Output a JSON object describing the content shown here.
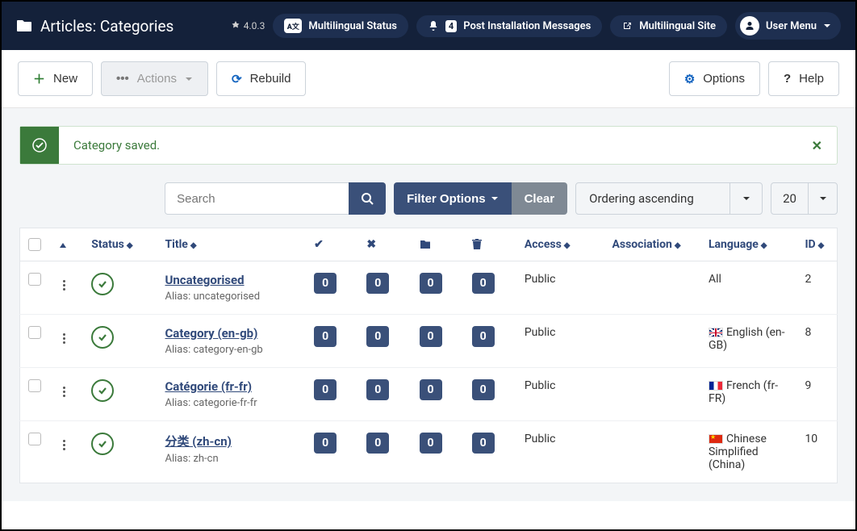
{
  "header": {
    "title": "Articles: Categories",
    "version": "4.0.3",
    "multilingual_status": "Multilingual Status",
    "notifications_count": "4",
    "post_install": "Post Installation Messages",
    "multilingual_site": "Multilingual Site",
    "user_menu": "User Menu"
  },
  "toolbar": {
    "new": "New",
    "actions": "Actions",
    "rebuild": "Rebuild",
    "options": "Options",
    "help": "Help"
  },
  "alert": {
    "message": "Category saved."
  },
  "filter": {
    "search_placeholder": "Search",
    "filter_options": "Filter Options",
    "clear": "Clear",
    "ordering": "Ordering ascending",
    "limit": "20"
  },
  "columns": {
    "status": "Status",
    "title": "Title",
    "access": "Access",
    "association": "Association",
    "language": "Language",
    "id": "ID"
  },
  "rows": [
    {
      "title": "Uncategorised",
      "alias": "Alias: uncategorised",
      "c1": "0",
      "c2": "0",
      "c3": "0",
      "c4": "0",
      "access": "Public",
      "language": "All",
      "flag": "",
      "id": "2"
    },
    {
      "title": "Category (en-gb)",
      "alias": "Alias: category-en-gb",
      "c1": "0",
      "c2": "0",
      "c3": "0",
      "c4": "0",
      "access": "Public",
      "language": "English (en-GB)",
      "flag": "gb",
      "id": "8"
    },
    {
      "title": "Catégorie (fr-fr)",
      "alias": "Alias: categorie-fr-fr",
      "c1": "0",
      "c2": "0",
      "c3": "0",
      "c4": "0",
      "access": "Public",
      "language": "French (fr-FR)",
      "flag": "fr",
      "id": "9"
    },
    {
      "title": "分类 (zh-cn)",
      "alias": "Alias: zh-cn",
      "c1": "0",
      "c2": "0",
      "c3": "0",
      "c4": "0",
      "access": "Public",
      "language": "Chinese Simplified (China)",
      "flag": "cn",
      "id": "10"
    }
  ]
}
